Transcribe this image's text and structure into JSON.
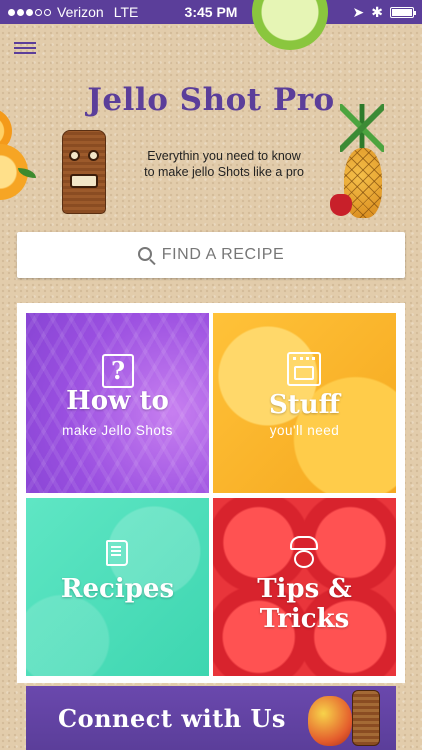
{
  "status_bar": {
    "carrier": "Verizon",
    "network": "LTE",
    "time": "3:45 PM",
    "signal_bars_filled": 3,
    "signal_bars_total": 5,
    "battery_level_percent": 100
  },
  "header": {
    "title": "Jello Shot Pro",
    "tagline_line1": "Everythin you need to know",
    "tagline_line2": "to make jello Shots like a pro"
  },
  "search": {
    "placeholder": "FIND A RECIPE"
  },
  "tiles": [
    {
      "title": "How to",
      "subtitle": "make Jello Shots",
      "icon": "question-icon",
      "color": "#9a4fe0"
    },
    {
      "title": "Stuff",
      "subtitle": "you'll need",
      "icon": "oven-icon",
      "color": "#ffc239"
    },
    {
      "title": "Recipes",
      "icon": "book-icon",
      "color": "#3dd6b0"
    },
    {
      "title": "Tips & Tricks",
      "icon": "chef-icon",
      "color": "#e9353b"
    }
  ],
  "connect": {
    "label": "Connect with Us"
  },
  "colors": {
    "brand_purple": "#5b3e9a",
    "background_sand": "#e2ccab"
  }
}
